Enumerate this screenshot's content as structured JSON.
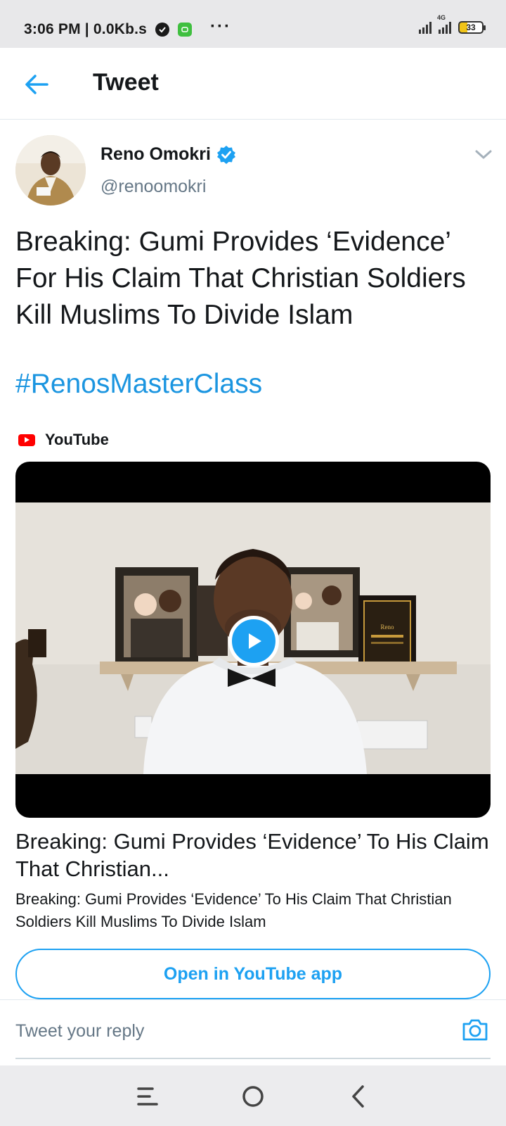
{
  "status_bar": {
    "time_speed": "3:06 PM | 0.0Kb.s",
    "dots": "···",
    "network": "4G",
    "battery": "33"
  },
  "header": {
    "title": "Tweet"
  },
  "tweet": {
    "author_name": "Reno Omokri",
    "handle": "@renoomokri",
    "text": "Breaking: Gumi Provides ‘Evidence’ For His Claim That Christian Soldiers Kill Muslims To Divide Islam",
    "hashtag": "#RenosMasterClass",
    "source_label": "YouTube"
  },
  "card": {
    "title": "Breaking: Gumi Provides ‘Evidence’ To His Claim That Christian...",
    "description": "Breaking: Gumi Provides ‘Evidence’ To His Claim That Christian Soldiers Kill Muslims To Divide Islam",
    "button_label": "Open in YouTube app",
    "plaque_text": "Reno"
  },
  "reply": {
    "placeholder": "Tweet your reply"
  },
  "colors": {
    "accent": "#1da1f2",
    "hashtag": "#1b95e0",
    "youtube_red": "#ff0000",
    "text_primary": "#14171a",
    "text_secondary": "#657786"
  },
  "icons": [
    "back-arrow-icon",
    "verified-badge-icon",
    "chevron-down-icon",
    "youtube-logo-icon",
    "play-icon",
    "camera-icon",
    "menu-icon",
    "home-circle-icon",
    "back-chevron-icon"
  ]
}
